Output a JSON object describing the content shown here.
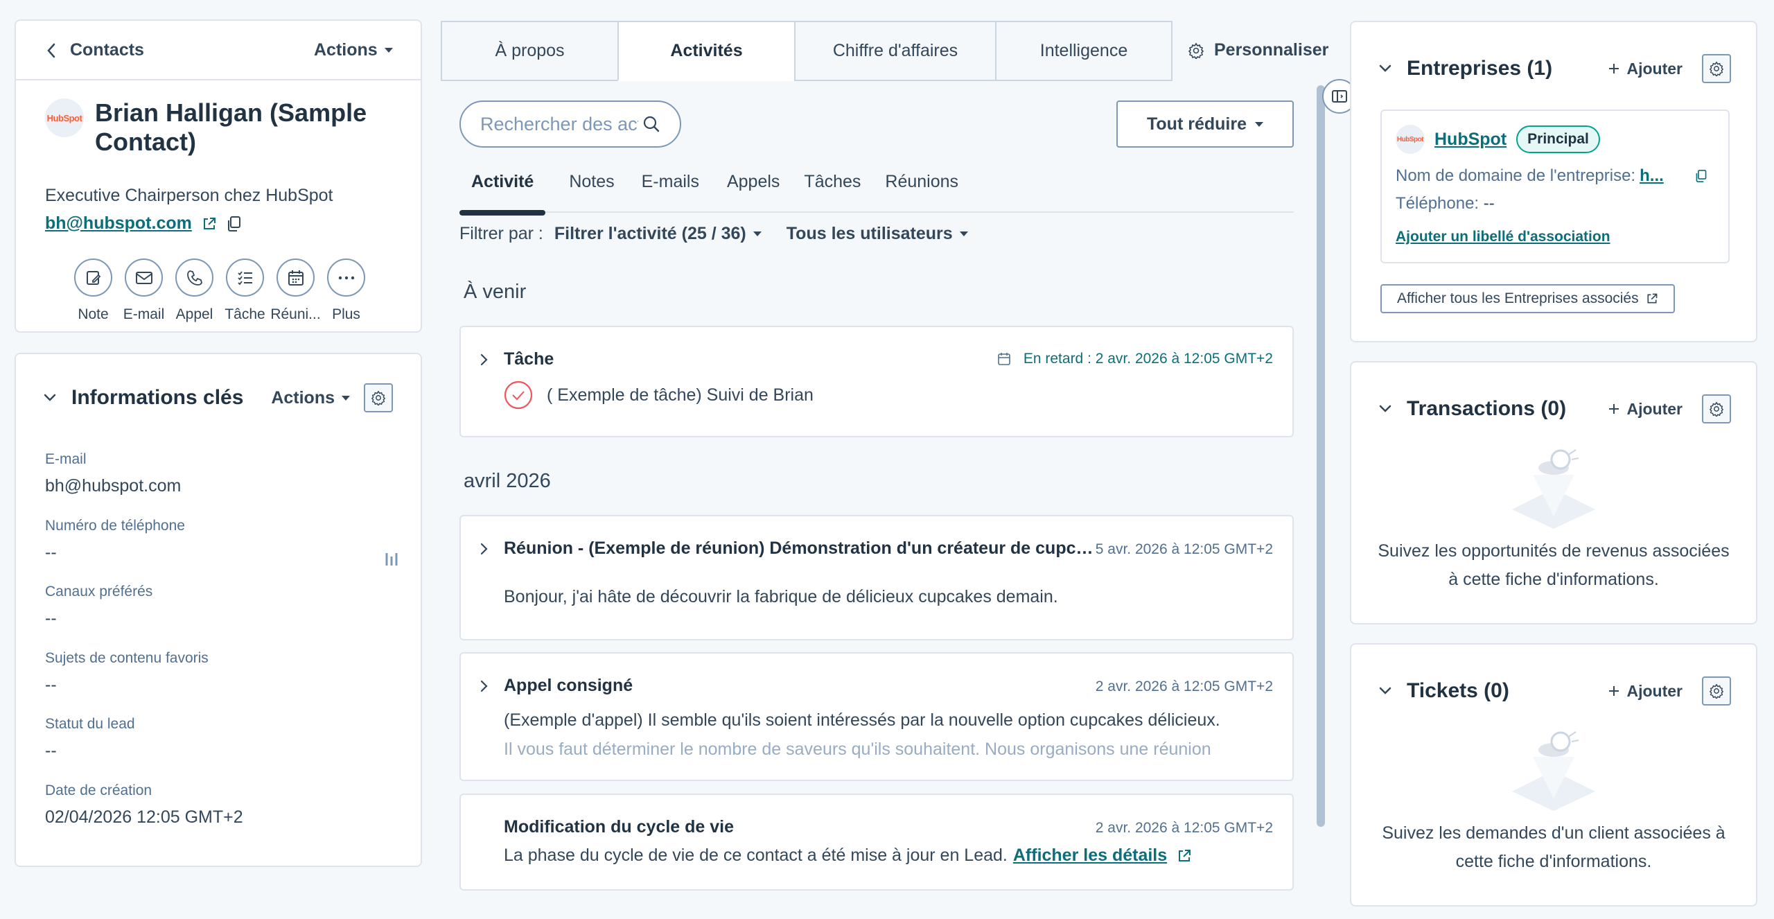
{
  "header": {
    "back_label": "Contacts",
    "actions_label": "Actions"
  },
  "contact": {
    "logo_text": "HubSpot",
    "name": "Brian Halligan (Sample Contact)",
    "title": "Executive Chairperson chez HubSpot",
    "email": "bh@hubspot.com"
  },
  "quick_actions": [
    {
      "label": "Note",
      "icon": "note-icon"
    },
    {
      "label": "E-mail",
      "icon": "email-icon"
    },
    {
      "label": "Appel",
      "icon": "phone-icon"
    },
    {
      "label": "Tâche",
      "icon": "task-icon"
    },
    {
      "label": "Réuni...",
      "icon": "meeting-icon"
    },
    {
      "label": "Plus",
      "icon": "more-icon"
    }
  ],
  "key_info": {
    "title": "Informations clés",
    "actions_label": "Actions",
    "fields": [
      {
        "label": "E-mail",
        "value": "bh@hubspot.com"
      },
      {
        "label": "Numéro de téléphone",
        "value": "--"
      },
      {
        "label": "Canaux préférés",
        "value": "--"
      },
      {
        "label": "Sujets de contenu favoris",
        "value": "--"
      },
      {
        "label": "Statut du lead",
        "value": "--"
      },
      {
        "label": "Date de création",
        "value": "02/04/2026 12:05 GMT+2"
      }
    ]
  },
  "tabs": [
    {
      "label": "À propos",
      "active": false
    },
    {
      "label": "Activités",
      "active": true
    },
    {
      "label": "Chiffre d'affaires",
      "active": false
    },
    {
      "label": "Intelligence",
      "active": false
    }
  ],
  "personalize_label": "Personnaliser",
  "search": {
    "placeholder": "Rechercher des activités"
  },
  "collapse_label": "Tout réduire",
  "subtabs": [
    {
      "label": "Activité",
      "active": true
    },
    {
      "label": "Notes"
    },
    {
      "label": "E-mails"
    },
    {
      "label": "Appels"
    },
    {
      "label": "Tâches"
    },
    {
      "label": "Réunions"
    }
  ],
  "filter": {
    "label": "Filtrer par :",
    "activity_filter": "Filtrer l'activité (25 / 36)",
    "users_filter": "Tous les utilisateurs"
  },
  "groups": {
    "upcoming": "À venir",
    "month": "avril 2026"
  },
  "activities": {
    "task": {
      "title": "Tâche",
      "timestamp": "En retard : 2 avr. 2026 à 12:05 GMT+2",
      "body": "( Exemple de tâche) Suivi de Brian"
    },
    "meeting": {
      "title": "Réunion - (Exemple de réunion) Démonstration d'un créateur de cupcakes",
      "timestamp": "5 avr. 2026 à 12:05 GMT+2",
      "body": "Bonjour, j'ai hâte de découvrir la fabrique de délicieux cupcakes demain."
    },
    "call": {
      "title": "Appel consigné",
      "timestamp": "2 avr. 2026 à 12:05 GMT+2",
      "body_line1": "(Exemple d'appel) Il semble qu'ils soient intéressés par la nouvelle option cupcakes délicieux.",
      "body_line2": "Il vous faut déterminer le nombre de saveurs qu'ils souhaitent. Nous organisons une réunion"
    },
    "lifecycle": {
      "title": "Modification du cycle de vie",
      "timestamp": "2 avr. 2026 à 12:05 GMT+2",
      "body": "La phase du cycle de vie de ce contact a été mise à jour en Lead.",
      "details_link": "Afficher les détails"
    }
  },
  "companies": {
    "title": "Entreprises (1)",
    "add_label": "Ajouter",
    "company": {
      "logo_text": "HubSpot",
      "name": "HubSpot",
      "badge": "Principal",
      "domain_label": "Nom de domaine de l'entreprise:",
      "domain_value": "h...",
      "phone_label": "Téléphone:",
      "phone_value": "--",
      "association_link": "Ajouter un libellé d'association"
    },
    "view_all_label": "Afficher tous les Entreprises associés"
  },
  "deals": {
    "title": "Transactions (0)",
    "add_label": "Ajouter",
    "empty_text": "Suivez les opportunités de revenus associées à cette fiche d'informations."
  },
  "tickets": {
    "title": "Tickets (0)",
    "add_label": "Ajouter",
    "empty_text": "Suivez les demandes d'un client associées à cette fiche d'informations."
  },
  "colors": {
    "primary_text": "#33475b",
    "link": "#0b6e78",
    "brand": "#ff5c35",
    "badge_border": "#00a38d"
  }
}
